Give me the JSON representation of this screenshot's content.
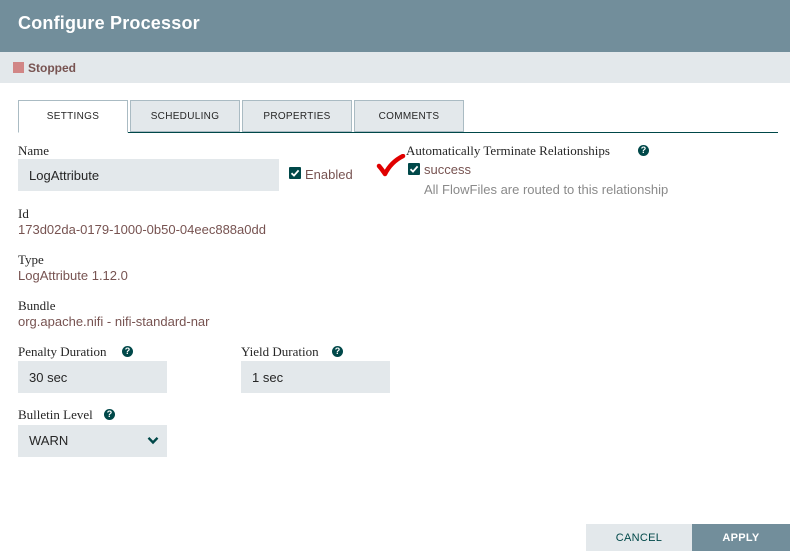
{
  "dialog": {
    "title": "Configure Processor",
    "status": "Stopped"
  },
  "tabs": [
    {
      "label": "SETTINGS",
      "active": true
    },
    {
      "label": "SCHEDULING",
      "active": false
    },
    {
      "label": "PROPERTIES",
      "active": false
    },
    {
      "label": "COMMENTS",
      "active": false
    }
  ],
  "settings": {
    "name_label": "Name",
    "name_value": "LogAttribute",
    "enabled_label": "Enabled",
    "enabled_checked": true,
    "id_label": "Id",
    "id_value": "173d02da-0179-1000-0b50-04eec888a0dd",
    "type_label": "Type",
    "type_value": "LogAttribute 1.12.0",
    "bundle_label": "Bundle",
    "bundle_value": "org.apache.nifi - nifi-standard-nar",
    "penalty_label": "Penalty Duration",
    "penalty_value": "30 sec",
    "yield_label": "Yield Duration",
    "yield_value": "1 sec",
    "bulletin_label": "Bulletin Level",
    "bulletin_value": "WARN"
  },
  "relationships": {
    "header": "Automatically Terminate Relationships",
    "items": [
      {
        "name": "success",
        "checked": true,
        "description": "All FlowFiles are routed to this relationship"
      }
    ]
  },
  "buttons": {
    "cancel": "CANCEL",
    "apply": "APPLY"
  },
  "colors": {
    "header_bg": "#728e9b",
    "accent": "#004849",
    "value_text": "#775351",
    "annotation_check": "#e00000"
  },
  "icons": {
    "help": "question-circle-icon",
    "check": "checkbox-checked-icon",
    "dropdown": "chevron-down-icon",
    "status": "stopped-square-icon"
  }
}
